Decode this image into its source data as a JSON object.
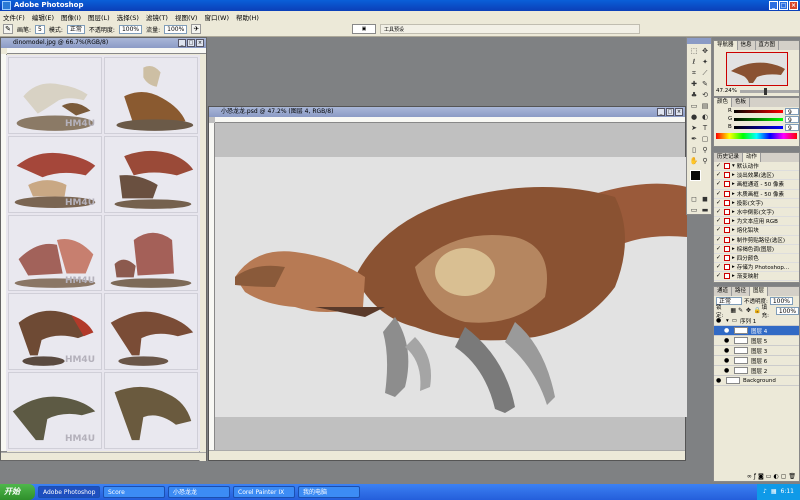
{
  "app": {
    "title": "Adobe Photoshop"
  },
  "menu": [
    "文件(F)",
    "编辑(E)",
    "图像(I)",
    "图层(L)",
    "选择(S)",
    "滤镜(T)",
    "视图(V)",
    "窗口(W)",
    "帮助(H)"
  ],
  "options": {
    "brush_label": "画笔:",
    "brush_size": "5",
    "mode_label": "模式:",
    "mode_value": "正常",
    "opacity_label": "不透明度:",
    "opacity_value": "100%",
    "flow_label": "流量:",
    "flow_value": "100%",
    "workspace": "工具预设"
  },
  "left_doc": {
    "title": "dinomodel.jpg @ 66.7%(RGB/8)",
    "watermark": "HM4U"
  },
  "main_doc": {
    "title": "小恐龙龙.psd @ 47.2% (图层 4, RGB/8)"
  },
  "navigator": {
    "tabs": [
      "导航器",
      "信息",
      "直方图"
    ],
    "zoom": "47.24%"
  },
  "color_panel": {
    "tabs": [
      "颜色",
      "色板"
    ],
    "r": "R",
    "g": "G",
    "b": "B",
    "r_val": "9",
    "g_val": "9",
    "b_val": "9"
  },
  "history": {
    "tabs": [
      "历史记录",
      "动作"
    ],
    "items": [
      "默认动作",
      "淡出效果(选区)",
      "画框通道 - 50 像素",
      "木质画框 - 50 像素",
      "投影(文字)",
      "水中倒影(文字)",
      "为文本应用 RGB",
      "熔化铅块",
      "制作剪贴路径(选区)",
      "棕褐色调(图层)",
      "四分颜色",
      "存储为 Photoshop...",
      "渐变映射"
    ]
  },
  "layers": {
    "tabs": [
      "通道",
      "路径",
      "图层"
    ],
    "blend": "正常",
    "opacity_label": "不透明度:",
    "opacity": "100%",
    "lock_label": "锁定:",
    "fill_label": "填充:",
    "fill": "100%",
    "group": "序列 1",
    "items": [
      "图层 4",
      "图层 5",
      "图层 3",
      "图层 6",
      "图层 2",
      "Background"
    ],
    "selected": "图层 4"
  },
  "taskbar": {
    "start": "开始",
    "tasks": [
      "Adobe Photoshop",
      "Score",
      "小恐龙龙",
      "Corel Painter IX",
      "我的电脑"
    ],
    "time": "6:11"
  },
  "colors": {
    "accent": "#316ac5",
    "title": "#0b4fd0"
  }
}
